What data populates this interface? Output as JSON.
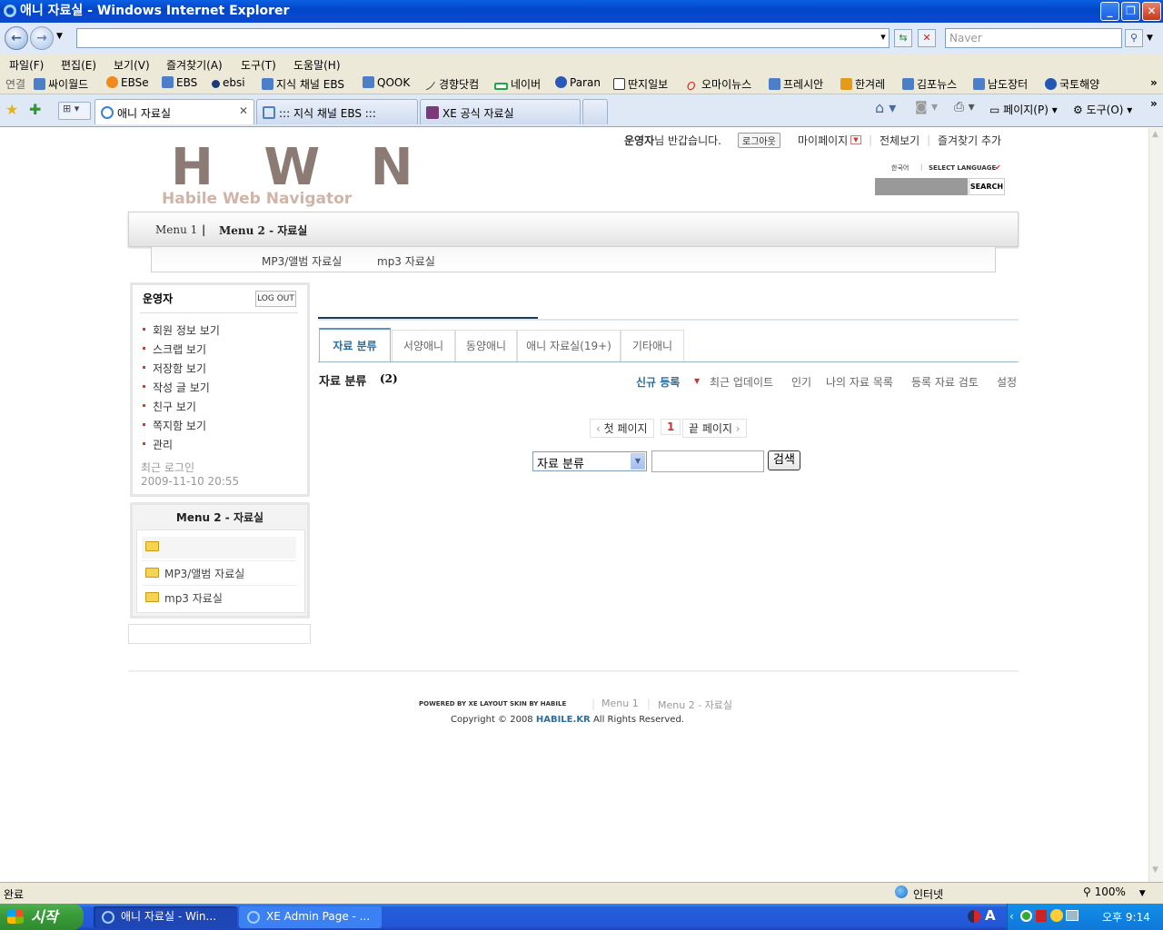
{
  "window": {
    "title": "애니 자료실 - Windows Internet Explorer"
  },
  "browser": {
    "address": "",
    "search_placeholder": "Naver",
    "menu": [
      "파일(F)",
      "편집(E)",
      "보기(V)",
      "즐겨찾기(A)",
      "도구(T)",
      "도움말(H)"
    ],
    "links_label": "연결",
    "links": [
      "싸이월드",
      "EBSe",
      "EBS",
      "ebsi",
      "지식 채널 EBS",
      "QOOK",
      "경향닷컴",
      "네이버",
      "Paran",
      "딴지일보",
      "오마이뉴스",
      "프레시안",
      "한겨레",
      "김포뉴스",
      "남도장터",
      "국토해양"
    ],
    "tabs": [
      "애니 자료실",
      "::: 지식 채널 EBS :::",
      "XE 공식 자료실"
    ],
    "tools": {
      "page": "페이지(P)",
      "tools": "도구(O)"
    },
    "status": {
      "left": "완료",
      "zone": "인터넷",
      "zoom": "100%"
    }
  },
  "site": {
    "greeting_user": "운영자",
    "greeting_suffix": "님 반갑습니다.",
    "logout_small": "로그아웃",
    "mypage": "마이페이지",
    "view_all": "전체보기",
    "add_favorite": "즐겨찾기 추가",
    "lang_current": "한국어",
    "lang_select": "SELECT LANGUAGE",
    "search_button": "SEARCH",
    "logo_big": "H W N",
    "logo_sub": "Habile Web Navigator",
    "nav": {
      "menu1": "Menu 1",
      "menu2": "Menu 2 - 자료실"
    },
    "subnav": [
      "MP3/앨범 자료실",
      "mp3 자료실"
    ],
    "login_box": {
      "user": "운영자",
      "logout_button": "LOG OUT",
      "items": [
        "회원 정보 보기",
        "스크랩 보기",
        "저장함 보기",
        "작성 글 보기",
        "친구 보기",
        "쪽지함 보기",
        "관리"
      ],
      "last_login_label": "최근 로그인",
      "last_login_time": "2009-11-10 20:55"
    },
    "side_menu": {
      "title": "Menu 2 - 자료실",
      "items": [
        "MP3/앨범 자료실",
        "mp3 자료실"
      ]
    },
    "cat_tabs": [
      "자료 분류",
      "서양애니",
      "동양애니",
      "애니 자료실(19+)",
      "기타애니"
    ],
    "section_title": "자료 분류",
    "section_count": "(2)",
    "actions": {
      "new": "신규 등록",
      "recent": "최근 업데이트",
      "popular": "인기",
      "mine": "나의 자료 목록",
      "review": "등록 자료 검토",
      "settings": "설정"
    },
    "pager": {
      "first": "첫 페이지",
      "current": "1",
      "last": "끝 페이지"
    },
    "search_select": "자료 분류",
    "search_btn": "검색",
    "footer": {
      "powered": "POWERED BY XE  LAYOUT SKIN BY HABILE",
      "link1": "Menu 1",
      "link2": "Menu 2 - 자료실",
      "copyright_pre": "Copyright © 2008 ",
      "copyright_site": "HABILE.KR",
      "copyright_post": " All Rights Reserved."
    }
  },
  "taskbar": {
    "start": "시작",
    "tasks": [
      "애니 자료실 - Win...",
      "XE Admin Page - ..."
    ],
    "clock": "오후 9:14"
  }
}
